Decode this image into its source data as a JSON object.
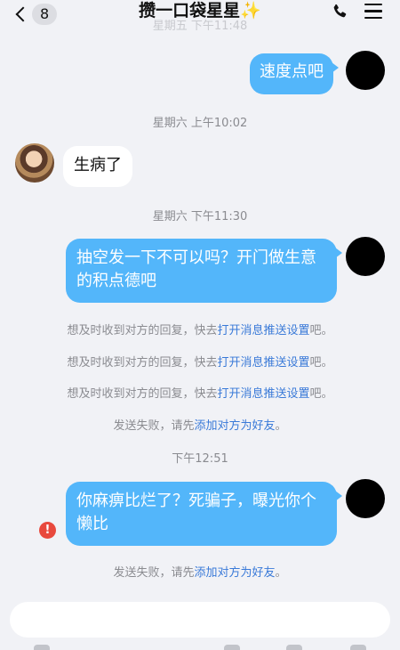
{
  "header": {
    "unread_count": "8",
    "title": "攒一口袋星星",
    "title_emoji": "✨"
  },
  "messages": {
    "cut_timestamp": "星期五 下午11:48",
    "out1": "速度点吧",
    "ts1": "星期六 上午10:02",
    "in1": "生病了",
    "ts2": "星期六 下午11:30",
    "out2": "抽空发一下不可以吗？开门做生意的积点德吧",
    "notice_prefix": "想及时收到对方的回复，快去",
    "notice_link": "打开消息推送设置",
    "notice_suffix": "吧。",
    "fail_prefix": "发送失败，请先",
    "fail_link": "添加对方为好友",
    "fail_suffix": "。",
    "ts3": "下午12:51",
    "out3": "你麻痹比烂了？死骗子，曝光你个懒比"
  },
  "input": {
    "placeholder": ""
  },
  "colors": {
    "bubble_out": "#53b6fa",
    "link": "#3a7ad8",
    "error": "#e8493d"
  }
}
